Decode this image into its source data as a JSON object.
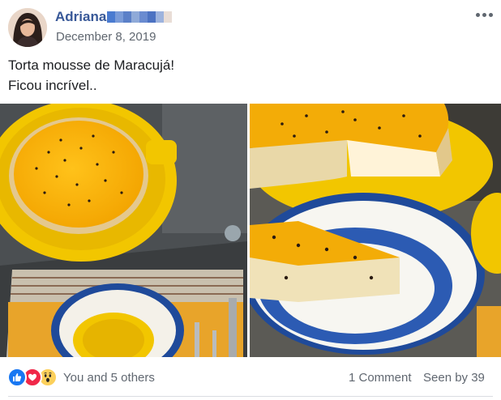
{
  "post": {
    "author_name": "Adriana",
    "date": "December 8, 2019",
    "text_lines": [
      "Torta mousse de Maracujá!",
      "Ficou incrível.."
    ],
    "photos": [
      {
        "icon": "passion-fruit-tart-photo"
      },
      {
        "icon": "tart-slice-photo"
      }
    ]
  },
  "footer": {
    "reactions_text": "You and 5 others",
    "reaction_icons": [
      "like-icon",
      "love-icon",
      "wow-icon"
    ],
    "comments": "1 Comment",
    "seen_by": "Seen by 39"
  },
  "colors": {
    "name_link": "#385898",
    "secondary_text": "#606770",
    "like_blue": "#1877f2",
    "love_red": "#f02849",
    "wow_yellow": "#fcd05b",
    "tart_yellow": "#f5b800",
    "plate_blue": "#1f4a9a"
  }
}
